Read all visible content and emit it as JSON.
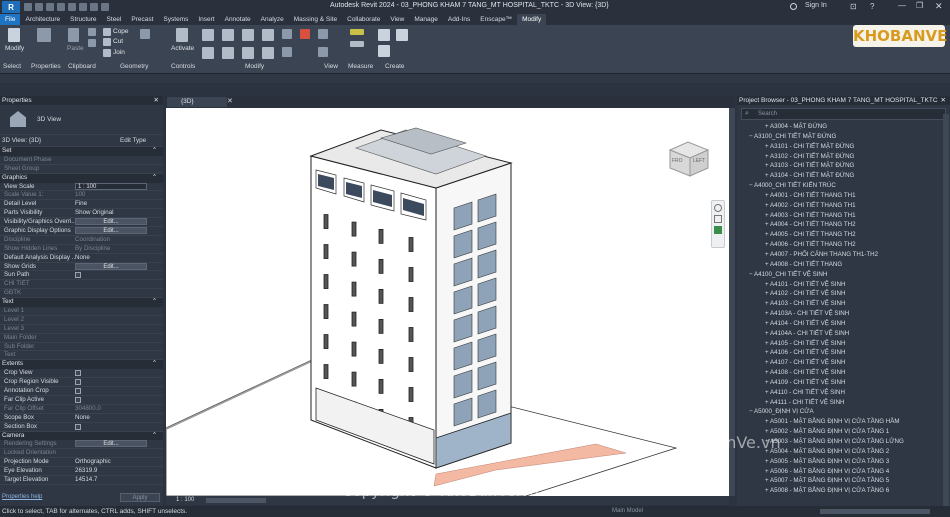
{
  "app_title": "Autodesk Revit 2024 - 03_PHONG KHAM 7 TANG_MT HOSPITAL_TKTC - 3D View: {3D}",
  "sign_in": "Sign In",
  "tabs": [
    "File",
    "Architecture",
    "Structure",
    "Steel",
    "Precast",
    "Systems",
    "Insert",
    "Annotate",
    "Analyze",
    "Massing & Site",
    "Collaborate",
    "View",
    "Manage",
    "Add-Ins",
    "Enscape™",
    "Modify"
  ],
  "ribbon": {
    "modify": "Modify",
    "paste": "Paste",
    "cope": "Cope",
    "cut": "Cut",
    "join": "Join",
    "activate": "Activate",
    "groups": [
      "Select",
      "Properties",
      "Clipboard",
      "Geometry",
      "Controls",
      "Modify",
      "View",
      "Measure",
      "Create"
    ]
  },
  "properties": {
    "title": "Properties",
    "type_name": "3D View",
    "selector": "3D View: {3D}",
    "edit_type": "Edit Type",
    "sections": [
      {
        "name": "Set",
        "rows": [
          {
            "k": "Document Phase",
            "v": "",
            "dim": true
          },
          {
            "k": "Sheet Group",
            "v": "",
            "dim": true
          }
        ]
      },
      {
        "name": "Graphics",
        "rows": [
          {
            "k": "View Scale",
            "v": "1 : 100",
            "box": true
          },
          {
            "k": "Scale Value    1:",
            "v": "100",
            "dim": true
          },
          {
            "k": "Detail Level",
            "v": "Fine"
          },
          {
            "k": "Parts Visibility",
            "v": "Show Original"
          },
          {
            "k": "Visibility/Graphics Overri...",
            "v": "Edit...",
            "btn": true
          },
          {
            "k": "Graphic Display Options",
            "v": "Edit...",
            "btn": true
          },
          {
            "k": "Discipline",
            "v": "Coordination",
            "dim": true
          },
          {
            "k": "Show Hidden Lines",
            "v": "By Discipline",
            "dim": true
          },
          {
            "k": "Default Analysis Display ...",
            "v": "None"
          },
          {
            "k": "Show Grids",
            "v": "Edit...",
            "btn": true
          },
          {
            "k": "Sun Path",
            "v": "",
            "chk": true
          },
          {
            "k": "CHI TIẾT",
            "v": "",
            "dim": true
          },
          {
            "k": "GĐTK",
            "v": "",
            "dim": true
          }
        ]
      },
      {
        "name": "Text",
        "rows": [
          {
            "k": "Level 1",
            "v": "",
            "dim": true
          },
          {
            "k": "Level 2",
            "v": "",
            "dim": true
          },
          {
            "k": "Level 3",
            "v": "",
            "dim": true
          },
          {
            "k": "Main Folder",
            "v": "",
            "dim": true
          },
          {
            "k": "Sub Folder",
            "v": "",
            "dim": true
          },
          {
            "k": "Text",
            "v": "",
            "dim": true
          }
        ]
      },
      {
        "name": "Extents",
        "rows": [
          {
            "k": "Crop View",
            "v": "",
            "chk": true
          },
          {
            "k": "Crop Region Visible",
            "v": "",
            "chk": true
          },
          {
            "k": "Annotation Crop",
            "v": "",
            "chk": true
          },
          {
            "k": "Far Clip Active",
            "v": "",
            "chk": true
          },
          {
            "k": "Far Clip Offset",
            "v": "304800.0",
            "dim": true
          },
          {
            "k": "Scope Box",
            "v": "None"
          },
          {
            "k": "Section Box",
            "v": "",
            "chk": true
          }
        ]
      },
      {
        "name": "Camera",
        "rows": [
          {
            "k": "Rendering Settings",
            "v": "Edit...",
            "btn": true,
            "dim": true
          },
          {
            "k": "Locked Orientation",
            "v": "",
            "dim": true
          },
          {
            "k": "Projection Mode",
            "v": "Orthographic"
          },
          {
            "k": "Eye Elevation",
            "v": "26319.9"
          },
          {
            "k": "Target Elevation",
            "v": "14514.7"
          }
        ]
      }
    ],
    "help": "Properties help",
    "apply": "Apply"
  },
  "view_tab": "{3D}",
  "view_scale": "1 : 100",
  "browser": {
    "title": "Project Browser - 03_PHONG KHAM 7 TANG_MT HOSPITAL_TKTC",
    "search": "Search",
    "items": [
      {
        "t": "A3004 - MẶT ĐỨNG",
        "lvl": "c"
      },
      {
        "t": "A3100_CHI TIẾT MẶT ĐỨNG",
        "lvl": "g"
      },
      {
        "t": "A3101 - CHI TIẾT MẶT ĐỨNG",
        "lvl": "c"
      },
      {
        "t": "A3102 - CHI TIẾT MẶT ĐỨNG",
        "lvl": "c"
      },
      {
        "t": "A3103 - CHI TIẾT MẶT ĐỨNG",
        "lvl": "c"
      },
      {
        "t": "A3104 - CHI TIẾT MẶT ĐỨNG",
        "lvl": "c"
      },
      {
        "t": "A4000_CHI TIẾT KIẾN TRÚC",
        "lvl": "g"
      },
      {
        "t": "A4001 - CHI TIẾT THANG TH1",
        "lvl": "c"
      },
      {
        "t": "A4002 - CHI TIẾT THANG TH1",
        "lvl": "c"
      },
      {
        "t": "A4003 - CHI TIẾT THANG TH1",
        "lvl": "c"
      },
      {
        "t": "A4004 - CHI TIẾT THANG TH2",
        "lvl": "c"
      },
      {
        "t": "A4005 - CHI TIẾT THANG TH2",
        "lvl": "c"
      },
      {
        "t": "A4006 - CHI TIẾT THANG TH2",
        "lvl": "c"
      },
      {
        "t": "A4007 - PHỐI CẢNH THANG TH1-TH2",
        "lvl": "c"
      },
      {
        "t": "A4008 - CHI TIẾT THANG",
        "lvl": "c"
      },
      {
        "t": "A4100_CHI TIẾT VỆ SINH",
        "lvl": "g"
      },
      {
        "t": "A4101 - CHI TIẾT VỆ SINH",
        "lvl": "c"
      },
      {
        "t": "A4102 - CHI TIẾT VỆ SINH",
        "lvl": "c"
      },
      {
        "t": "A4103 - CHI TIẾT VỆ SINH",
        "lvl": "c"
      },
      {
        "t": "A4103A - CHI TIẾT VỆ SINH",
        "lvl": "c"
      },
      {
        "t": "A4104 - CHI TIẾT VỆ SINH",
        "lvl": "c"
      },
      {
        "t": "A4104A - CHI TIẾT VỆ SINH",
        "lvl": "c"
      },
      {
        "t": "A4105 - CHI TIẾT VỆ SINH",
        "lvl": "c"
      },
      {
        "t": "A4106 - CHI TIẾT VỆ SINH",
        "lvl": "c"
      },
      {
        "t": "A4107 - CHI TIẾT VỆ SINH",
        "lvl": "c"
      },
      {
        "t": "A4108 - CHI TIẾT VỆ SINH",
        "lvl": "c"
      },
      {
        "t": "A4109 - CHI TIẾT VỆ SINH",
        "lvl": "c"
      },
      {
        "t": "A4110 - CHI TIẾT VỆ SINH",
        "lvl": "c"
      },
      {
        "t": "A4111 - CHI TIẾT VỆ SINH",
        "lvl": "c"
      },
      {
        "t": "A5000_ĐỊNH VỊ CỬA",
        "lvl": "g"
      },
      {
        "t": "A5001 - MẶT BẰNG ĐỊNH VỊ CỬA TẦNG HẦM",
        "lvl": "c"
      },
      {
        "t": "A5002 - MẶT BẰNG ĐỊNH VỊ CỬA TẦNG 1",
        "lvl": "c"
      },
      {
        "t": "A5003 - MẶT BẰNG ĐỊNH VỊ CỬA TẦNG LỬNG",
        "lvl": "c"
      },
      {
        "t": "A5004 - MẶT BẰNG ĐỊNH VỊ CỬA TẦNG 2",
        "lvl": "c"
      },
      {
        "t": "A5005 - MẶT BẰNG ĐỊNH VỊ CỬA TẦNG 3",
        "lvl": "c"
      },
      {
        "t": "A5006 - MẶT BẰNG ĐỊNH VỊ CỬA TẦNG 4",
        "lvl": "c"
      },
      {
        "t": "A5007 - MẶT BẰNG ĐỊNH VỊ CỬA TẦNG 5",
        "lvl": "c"
      },
      {
        "t": "A5008 - MẶT BẰNG ĐỊNH VỊ CỬA TẦNG 6",
        "lvl": "c"
      }
    ]
  },
  "status": "Click to select, TAB for alternates, CTRL adds, SHIFT unselects.",
  "model": "Main Model",
  "logo": "KHOBANVE",
  "watermark1": "KhoBanVe.vn",
  "watermark2": "Copyright © KhoBanVe.vn",
  "viewcube": {
    "front": "FRO",
    "right": "LEFT"
  }
}
